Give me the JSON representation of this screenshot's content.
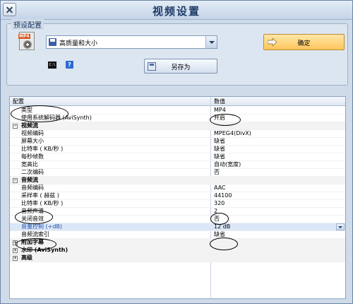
{
  "window": {
    "title": "视频设置"
  },
  "preset": {
    "legend": "预设配置",
    "file_icon_label": "MP4",
    "selected": "高质量和大小",
    "ok_label": "确定",
    "saveas_label": "另存为"
  },
  "grid": {
    "headers": {
      "name": "配置",
      "value": "数值"
    },
    "rows": [
      {
        "name": "类型",
        "value": "MP4"
      },
      {
        "name": "使用系统解码器 (AviSynth)",
        "value": "开启"
      },
      {
        "name": "视频流",
        "value": ""
      },
      {
        "name": "视频编码",
        "value": "MPEG4(DivX)"
      },
      {
        "name": "屏幕大小",
        "value": "缺省"
      },
      {
        "name": "比特率 ( KB/秒 )",
        "value": "缺省"
      },
      {
        "name": "每秒帧数",
        "value": "缺省"
      },
      {
        "name": "宽高比",
        "value": "自动(宽度)"
      },
      {
        "name": "二次编码",
        "value": "否"
      },
      {
        "name": "音频流",
        "value": ""
      },
      {
        "name": "音频编码",
        "value": "AAC"
      },
      {
        "name": "采样率 ( 赫兹 )",
        "value": "44100"
      },
      {
        "name": "比特率 ( KB/秒 )",
        "value": "320"
      },
      {
        "name": "音频声道",
        "value": "2"
      },
      {
        "name": "关闭音效",
        "value": "否"
      },
      {
        "name": "音量控制 (+dB)",
        "value": "12 dB"
      },
      {
        "name": "音频流索引",
        "value": "缺省"
      },
      {
        "name": "附加字幕",
        "value": ""
      },
      {
        "name": "水印 (AviSynth)",
        "value": ""
      },
      {
        "name": "高级",
        "value": ""
      }
    ],
    "expander_collapsed": "+",
    "expander_expanded": "−"
  },
  "icons": {
    "cmd": "C:\\",
    "help": "?"
  },
  "watermark": {
    "brand": "Bai 经验",
    "url": "jingyan.baidu.com"
  }
}
